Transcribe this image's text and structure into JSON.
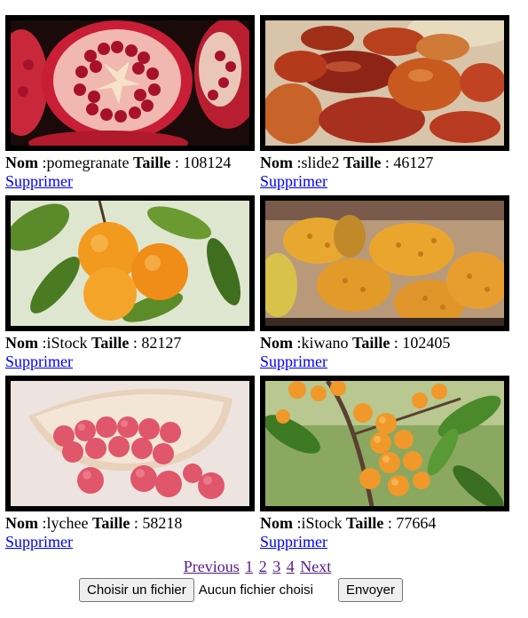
{
  "cards": [
    {
      "label_nom": "Nom",
      "name": " :pomegranate ",
      "label_taille": "Taille",
      "size": " : 108124",
      "delete": "Supprimer"
    },
    {
      "label_nom": "Nom",
      "name": " :slide2 ",
      "label_taille": "Taille",
      "size": " : 46127",
      "delete": "Supprimer"
    },
    {
      "label_nom": "Nom",
      "name": " :iStock ",
      "label_taille": "Taille",
      "size": " : 82127",
      "delete": "Supprimer"
    },
    {
      "label_nom": "Nom",
      "name": " :kiwano ",
      "label_taille": "Taille",
      "size": " : 102405",
      "delete": "Supprimer"
    },
    {
      "label_nom": "Nom",
      "name": " :lychee ",
      "label_taille": "Taille",
      "size": " : 58218",
      "delete": "Supprimer"
    },
    {
      "label_nom": "Nom",
      "name": " :iStock ",
      "label_taille": "Taille",
      "size": " : 77664",
      "delete": "Supprimer"
    }
  ],
  "pagination": {
    "previous": "Previous",
    "pages": [
      "1",
      "2",
      "3",
      "4"
    ],
    "next": "Next"
  },
  "upload": {
    "choose_label": "Choisir un fichier",
    "no_file": "Aucun fichier choisi",
    "submit_label": "Envoyer"
  }
}
